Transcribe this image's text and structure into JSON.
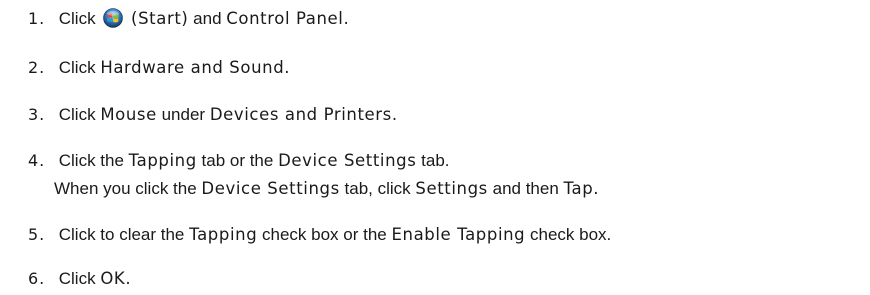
{
  "steps": [
    {
      "number": "1.",
      "text_1": "Click",
      "icon": "windows-start-orb-icon",
      "ui_1": "(Start)",
      "text_2": "and",
      "ui_2": "Control Panel."
    },
    {
      "number": "2.",
      "text_1": "Click",
      "ui_1": "Hardware and Sound."
    },
    {
      "number": "3.",
      "text_1": "Click",
      "ui_1": "Mouse",
      "text_2": "under",
      "ui_2": "Devices and Printers."
    },
    {
      "number": "4.",
      "text_1": "Click the",
      "ui_1": "Tapping",
      "text_2": "tab or the",
      "ui_2": "Device Settings",
      "text_3": "tab.",
      "sub": {
        "text_1": "When you click the",
        "ui_1": "Device Settings",
        "text_2": "tab, click",
        "ui_2": "Settings",
        "text_3": "and then",
        "ui_3": "Tap."
      }
    },
    {
      "number": "5.",
      "text_1": "Click to clear the",
      "ui_1": "Tapping",
      "text_2": "check box or the",
      "ui_2": "Enable Tapping",
      "text_3": "check box."
    },
    {
      "number": "6.",
      "text_1": "Click",
      "ui_1": "OK."
    }
  ]
}
